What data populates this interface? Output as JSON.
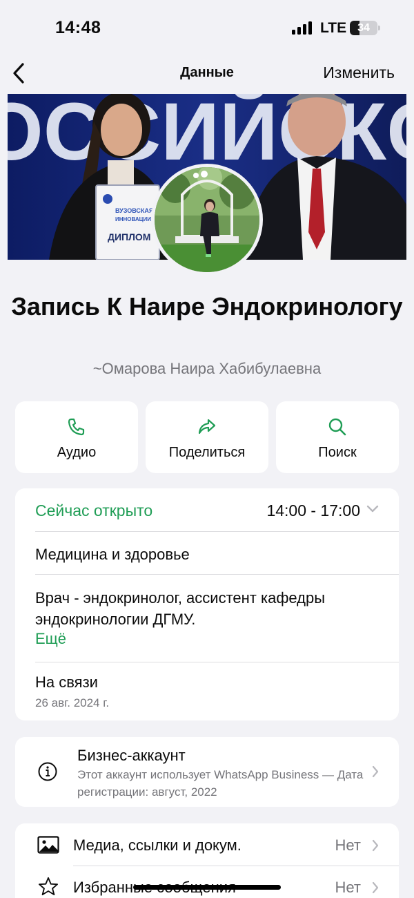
{
  "status_bar": {
    "time": "14:48",
    "network": "LTE",
    "battery": "34",
    "battery_level": 0.34
  },
  "nav": {
    "title": "Данные",
    "edit_label": "Изменить"
  },
  "profile": {
    "name": "Запись К Наире Эндокринологу",
    "subtitle": "~Омарова Наира Хабибулаевна"
  },
  "cover": {
    "certificate_line1": "ВУЗОВСКАЯ",
    "certificate_line2": "ИННОВАЦИИ",
    "certificate_label": "ДИПЛОМ",
    "backdrop_text": "ОССИЙСКОЙ"
  },
  "actions": [
    {
      "label": "Аудио",
      "icon": "phone-icon"
    },
    {
      "label": "Поделиться",
      "icon": "share-icon"
    },
    {
      "label": "Поиск",
      "icon": "search-icon"
    }
  ],
  "info": {
    "open_status": "Сейчас открыто",
    "hours": "14:00 - 17:00",
    "category": "Медицина и здоровье",
    "description": "Врач - эндокринолог, ассистент кафедры эндокринологии ДГМУ.",
    "more_label": "Ещё",
    "online_label": "На связи",
    "online_date": "26 авг. 2024 г."
  },
  "business": {
    "title": "Бизнес-аккаунт",
    "text": "Этот аккаунт использует WhatsApp Business — Дата регистрации: август, 2022"
  },
  "list": [
    {
      "label": "Медиа, ссылки и докум.",
      "value": "Нет",
      "icon": "photo-icon"
    },
    {
      "label": "Избранные сообщения",
      "value": "Нет",
      "icon": "star-icon"
    }
  ],
  "colors": {
    "accent": "#1f9d55",
    "background": "#f2f2f6",
    "secondary_text": "#75757a"
  }
}
